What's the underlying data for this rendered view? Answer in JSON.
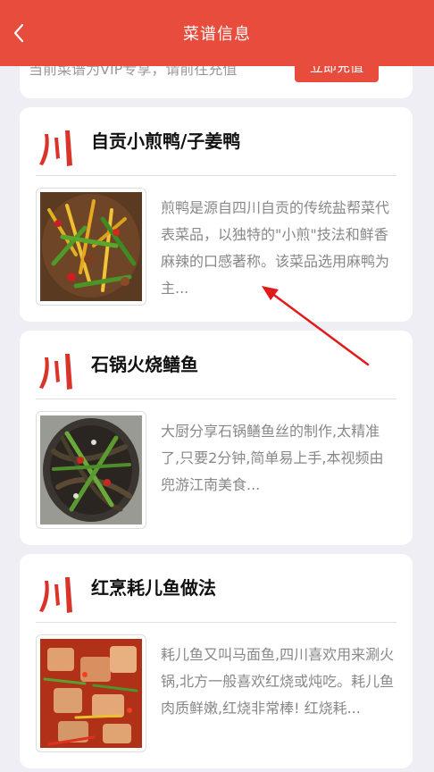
{
  "header": {
    "title": "菜谱信息"
  },
  "vip": {
    "notice": "当前菜谱为VIP专享，请前往充值",
    "button": "立即充值"
  },
  "recipes": [
    {
      "name": "自贡小煎鸭/子姜鸭",
      "description": "煎鸭是源自四川自贡的传统盐帮菜代表菜品，以独特的\"小煎\"技法和鲜香麻辣的口感著称。该菜品选用麻鸭为主..."
    },
    {
      "name": "石锅火烧鳝鱼",
      "description": "大厨分享石锅鳝鱼丝的制作,太精准了,只要2分钟,简单易上手,本视频由兜游江南美食..."
    },
    {
      "name": "红烹耗儿鱼做法",
      "description": "耗儿鱼又叫马面鱼,四川喜欢用来涮火锅,北方一般喜欢红烧或炖吃。耗儿鱼肉质鲜嫩,红烧非常棒! 红烧耗..."
    }
  ],
  "colors": {
    "accent": "#e74c3c",
    "background": "#eeeef4"
  }
}
